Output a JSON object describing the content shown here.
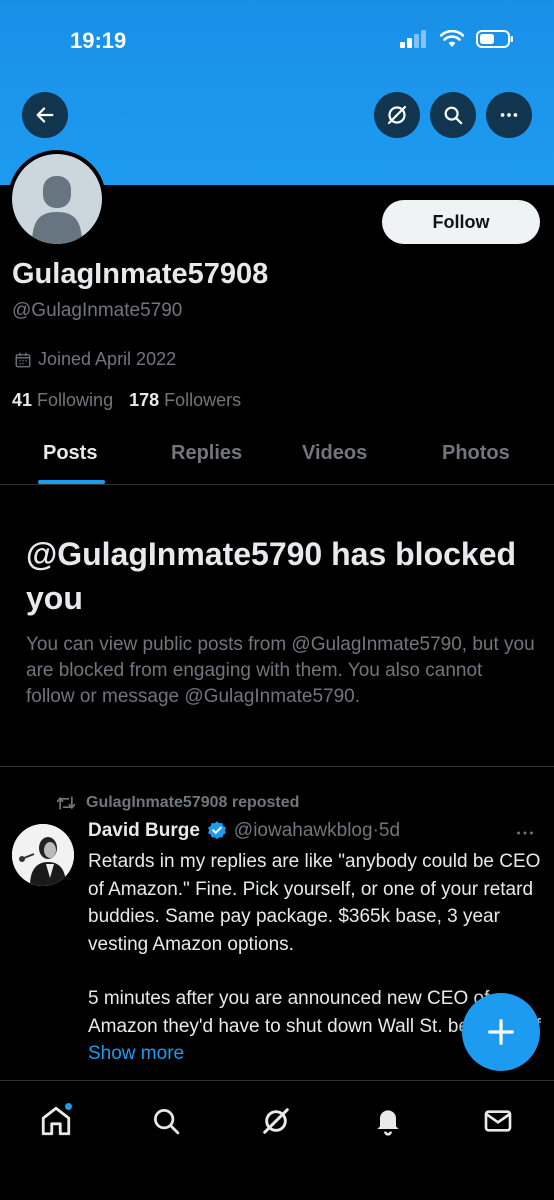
{
  "status": {
    "time": "19:19"
  },
  "profile": {
    "display_name": "GulagInmate57908",
    "handle": "@GulagInmate5790",
    "joined": "Joined April 2022",
    "following_count": "41",
    "following_label": "Following",
    "followers_count": "178",
    "followers_label": "Followers",
    "follow_label": "Follow"
  },
  "tabs": [
    {
      "label": "Posts",
      "active": true
    },
    {
      "label": "Replies",
      "active": false
    },
    {
      "label": "Videos",
      "active": false
    },
    {
      "label": "Photos",
      "active": false
    }
  ],
  "block_notice": {
    "title": "@GulagInmate5790 has blocked you",
    "description": "You can view public posts from @GulagInmate5790, but you are blocked from engaging with them. You also cannot follow or message @GulagInmate5790."
  },
  "post": {
    "repost_label": "GulagInmate57908 reposted",
    "author": "David Burge",
    "handle": "@iowahawkblog",
    "separator": "·",
    "time": "5d",
    "paragraph1": "Retards in my replies are like \"anybody could be CEO of Amazon.\" Fine. Pick yourself, or one of your retard buddies. Same pay package. $365k base, 3 year vesting Amazon options.",
    "paragraph2": "5 minutes after you are announced new CEO of Amazon they'd have to shut down Wall St. because of",
    "show_more": "Show more"
  },
  "icons": {
    "back": "arrow-left-icon",
    "grok": "no-grok-icon",
    "search": "search-icon",
    "more": "more-horizontal-icon",
    "calendar": "calendar-icon",
    "repost": "repost-icon",
    "verified": "verified-badge-icon",
    "compose": "plus-icon",
    "nav": [
      "home-icon",
      "search-icon",
      "grok-icon",
      "notifications-bell-icon",
      "mail-icon"
    ]
  },
  "colors": {
    "accent": "#1d9bf0",
    "background": "#000000",
    "text_primary": "#e7e9ea",
    "text_secondary": "#71767b"
  }
}
